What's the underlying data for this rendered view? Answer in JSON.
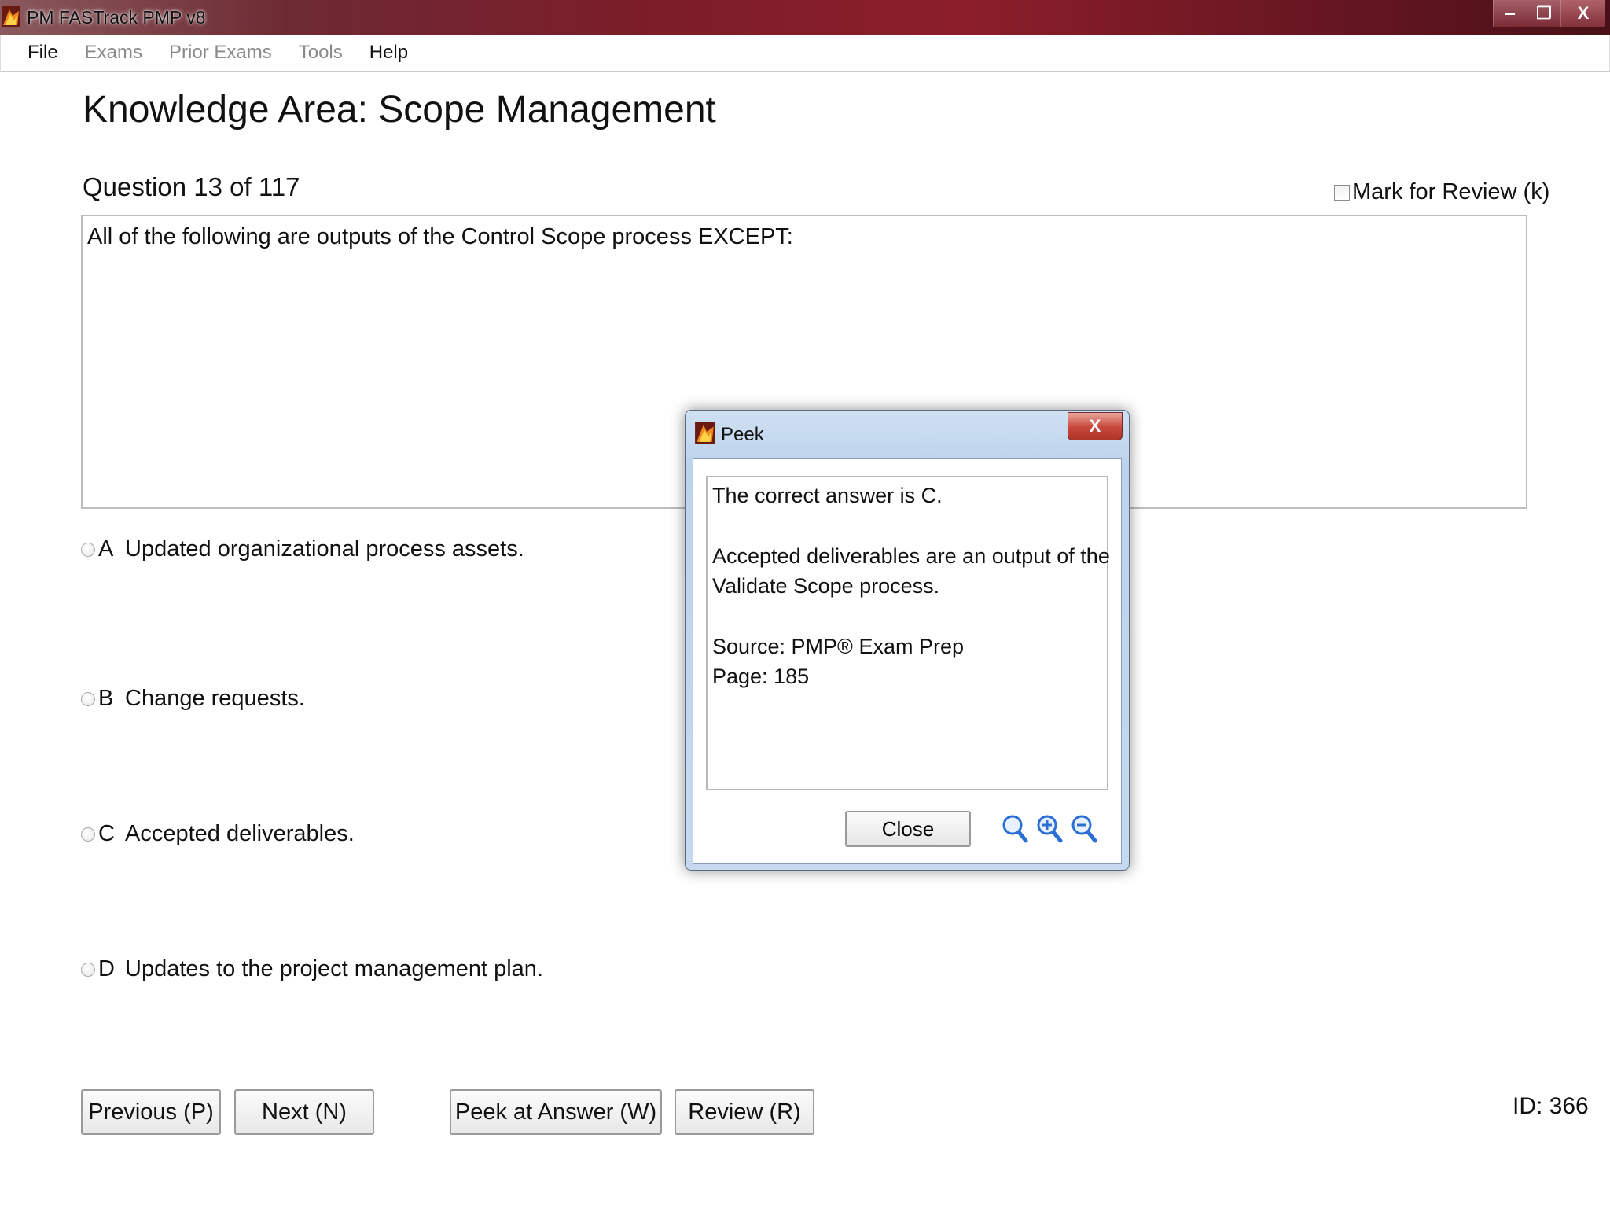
{
  "window": {
    "title": "PM FASTrack PMP v8",
    "minimize_glyph": "‒",
    "restore_glyph": "❐",
    "close_glyph": "X"
  },
  "menu": {
    "items": [
      {
        "label": "File",
        "enabled": true
      },
      {
        "label": "Exams",
        "enabled": false
      },
      {
        "label": "Prior Exams",
        "enabled": false
      },
      {
        "label": "Tools",
        "enabled": false
      },
      {
        "label": "Help",
        "enabled": true
      }
    ]
  },
  "page": {
    "heading": "Knowledge Area: Scope Management",
    "question_counter": "Question 13 of 117",
    "mark_for_review": "Mark for Review (k)",
    "question_text": "All of the following are outputs of the Control Scope process EXCEPT:",
    "options": [
      {
        "letter": "A",
        "text": "Updated organizational process assets."
      },
      {
        "letter": "B",
        "text": "Change requests."
      },
      {
        "letter": "C",
        "text": "Accepted deliverables."
      },
      {
        "letter": "D",
        "text": "Updates to the project management plan."
      }
    ],
    "buttons": {
      "previous": "Previous (P)",
      "next": "Next (N)",
      "peek": "Peek at Answer (W)",
      "review": "Review (R)"
    },
    "id_label": "ID: 366"
  },
  "peek_dialog": {
    "title": "Peek",
    "close_glyph": "X",
    "answer_lines": [
      "The correct answer is C.",
      "Accepted deliverables are an output of the",
      "Validate Scope process.",
      "Source: PMP® Exam Prep",
      "Page: 185"
    ],
    "close_label": "Close",
    "icons": [
      "magnifier-icon",
      "zoom-in-icon",
      "zoom-out-icon"
    ]
  },
  "colors": {
    "titlebar_accent": "#7b1d29",
    "dialog_frame": "#bcd3ec",
    "dialog_close": "#c8463a",
    "zoom_icon": "#2b6fd6"
  }
}
